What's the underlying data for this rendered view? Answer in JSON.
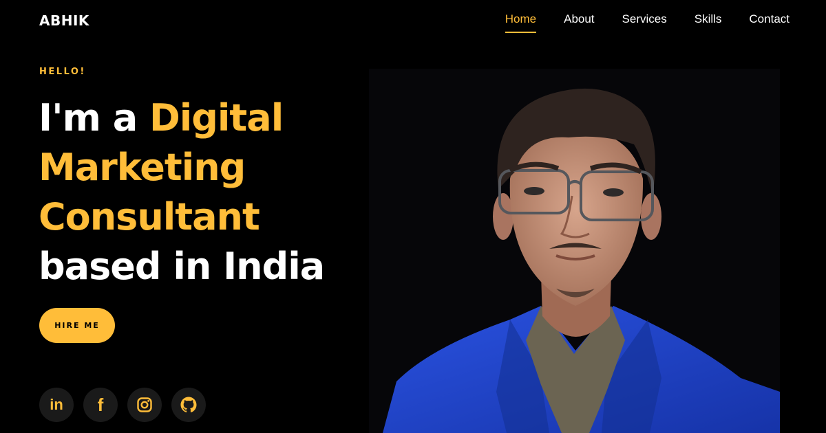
{
  "brand": {
    "logo": "ABHIK"
  },
  "nav": {
    "items": [
      {
        "label": "Home",
        "active": true
      },
      {
        "label": "About"
      },
      {
        "label": "Services"
      },
      {
        "label": "Skills"
      },
      {
        "label": "Contact"
      }
    ]
  },
  "hero": {
    "greeting": "HELLO!",
    "headline": {
      "prefix": "I'm a ",
      "line1_highlight": "Digital",
      "line2_highlight": "Marketing",
      "line3_highlight": "Consultant",
      "line4": "based in India"
    },
    "cta_label": "HIRE ME"
  },
  "socials": [
    {
      "name": "linkedin",
      "icon": "linkedin-icon",
      "glyph": "in"
    },
    {
      "name": "facebook",
      "icon": "facebook-icon",
      "glyph": "f"
    },
    {
      "name": "instagram",
      "icon": "instagram-icon"
    },
    {
      "name": "github",
      "icon": "github-icon"
    }
  ],
  "theme": {
    "accent": "#ffbd39",
    "background": "#000000",
    "suit_blue": "#1f44c9"
  }
}
